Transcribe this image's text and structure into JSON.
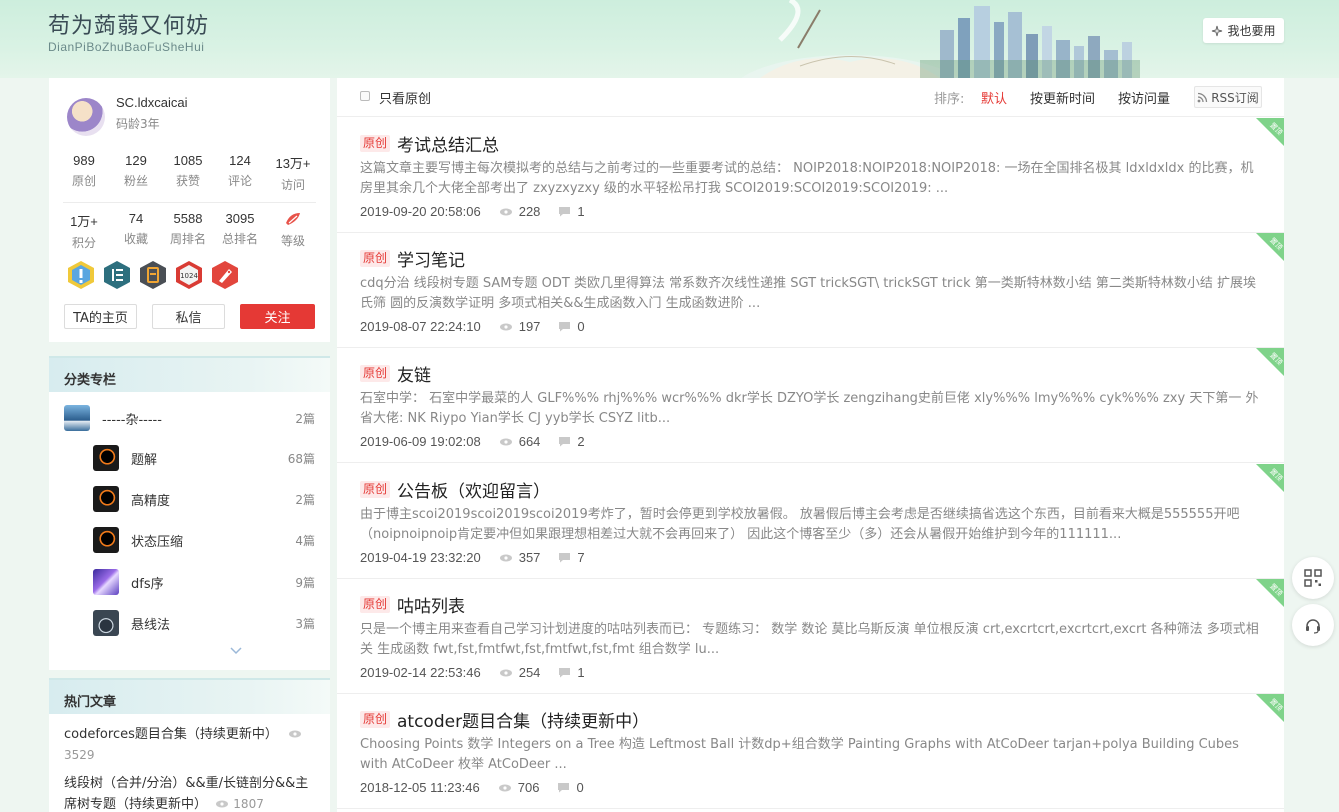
{
  "header": {
    "title": "苟为蒟蒻又何妨",
    "subtitle": "DianPiBoZhuBaoFuSheHui",
    "want_label": "我也要用"
  },
  "profile": {
    "name": "SC.ldxcaicai",
    "age": "码龄3年",
    "stats_row1": [
      {
        "num": "989",
        "label": "原创"
      },
      {
        "num": "129",
        "label": "粉丝"
      },
      {
        "num": "1085",
        "label": "获赞"
      },
      {
        "num": "124",
        "label": "评论"
      },
      {
        "num": "13万+",
        "label": "访问"
      }
    ],
    "stats_row2": [
      {
        "num": "1万+",
        "label": "积分"
      },
      {
        "num": "74",
        "label": "收藏"
      },
      {
        "num": "5588",
        "label": "周排名"
      },
      {
        "num": "3095",
        "label": "总排名"
      },
      {
        "num": "",
        "label": "等级"
      }
    ],
    "badge_1024": "1024",
    "home_label": "TA的主页",
    "msg_label": "私信",
    "follow_label": "关注"
  },
  "categories": {
    "heading": "分类专栏",
    "items": [
      {
        "name": "-----杂-----",
        "count": "2篇"
      },
      {
        "name": "题解",
        "count": "68篇"
      },
      {
        "name": "高精度",
        "count": "2篇"
      },
      {
        "name": "状态压缩",
        "count": "4篇"
      },
      {
        "name": "dfs序",
        "count": "9篇"
      },
      {
        "name": "悬线法",
        "count": "3篇"
      }
    ]
  },
  "hot": {
    "heading": "热门文章",
    "items": [
      {
        "title": "codeforces题目合集（持续更新中）",
        "views": "3529"
      },
      {
        "title": "线段树（合并/分治）&&重/长链剖分&&主席树专题（持续更新中）",
        "views": "1807"
      }
    ]
  },
  "toolbar": {
    "only_original": "只看原创",
    "sort_label": "排序:",
    "sort_default": "默认",
    "sort_update": "按更新时间",
    "sort_views": "按访问量",
    "rss": "RSS订阅"
  },
  "articles": [
    {
      "tag": "原创",
      "title": "考试总结汇总",
      "summary": "这篇文章主要写博主每次模拟考的总结与之前考过的一些重要考试的总结： NOIP2018:NOIP2018:NOIP2018: 一场在全国排名极其 ldxldxldx 的比赛，机房里其余几个大佬全部考出了 zxyzxyzxy 级的水平轻松吊打我 SCOI2019:SCOI2019:SCOI2019: ...",
      "date": "2019-09-20 20:58:06",
      "views": "228",
      "comments": "1",
      "ribbon": "置顶"
    },
    {
      "tag": "原创",
      "title": "学习笔记",
      "summary": "cdq分治 线段树专题 SAM专题 ODT 类欧几里得算法 常系数齐次线性递推 SGT trickSGT\\ trickSGT trick 第一类斯特林数小结 第二类斯特林数小结 扩展埃氏筛 圆的反演数学证明 多项式相关&&生成函数入门 生成函数进阶 ...",
      "date": "2019-08-07 22:24:10",
      "views": "197",
      "comments": "0",
      "ribbon": "置顶"
    },
    {
      "tag": "原创",
      "title": "友链",
      "summary": "石室中学： 石室中学最菜的人 GLF%%% rhj%%% wcr%%% dkr学长 DZYO学长 zengzihang史前巨佬 xly%%% lmy%%% cyk%%% zxy 天下第一 外省大佬: NK Riypo Yian学长 CJ yyb学长 CSYZ litb...",
      "date": "2019-06-09 19:02:08",
      "views": "664",
      "comments": "2",
      "ribbon": "置顶"
    },
    {
      "tag": "原创",
      "title": "公告板（欢迎留言）",
      "summary": "由于博主scoi2019scoi2019scoi2019考炸了，暂时会停更到学校放暑假。 放暑假后博主会考虑是否继续搞省选这个东西，目前看来大概是555555开吧（noipnoipnoip肯定要冲但如果跟理想相差过大就不会再回来了） 因此这个博客至少（多）还会从暑假开始维护到今年的111111...",
      "date": "2019-04-19 23:32:20",
      "views": "357",
      "comments": "7",
      "ribbon": "置顶"
    },
    {
      "tag": "原创",
      "title": "咕咕列表",
      "summary": "只是一个博主用来查看自己学习计划进度的咕咕列表而已： 专题练习： 数学 数论 莫比乌斯反演 单位根反演 crt,excrtcrt,excrtcrt,excrt 各种筛法 多项式相关 生成函数 fwt,fst,fmtfwt,fst,fmtfwt,fst,fmt 组合数学 lu...",
      "date": "2019-02-14 22:53:46",
      "views": "254",
      "comments": "1",
      "ribbon": "置顶"
    },
    {
      "tag": "原创",
      "title": "atcoder题目合集（持续更新中）",
      "summary": "Choosing Points 数学 Integers on a Tree 构造 Leftmost Ball 计数dp+组合数学 Painting Graphs with AtCoDeer tarjan+polya Building Cubes with AtCoDeer 枚举 AtCoDeer ...",
      "date": "2018-12-05 11:23:46",
      "views": "706",
      "comments": "0",
      "ribbon": "置顶"
    }
  ],
  "colors": {
    "accent_red": "#e53935",
    "ribbon_green": "#7fd38a"
  }
}
